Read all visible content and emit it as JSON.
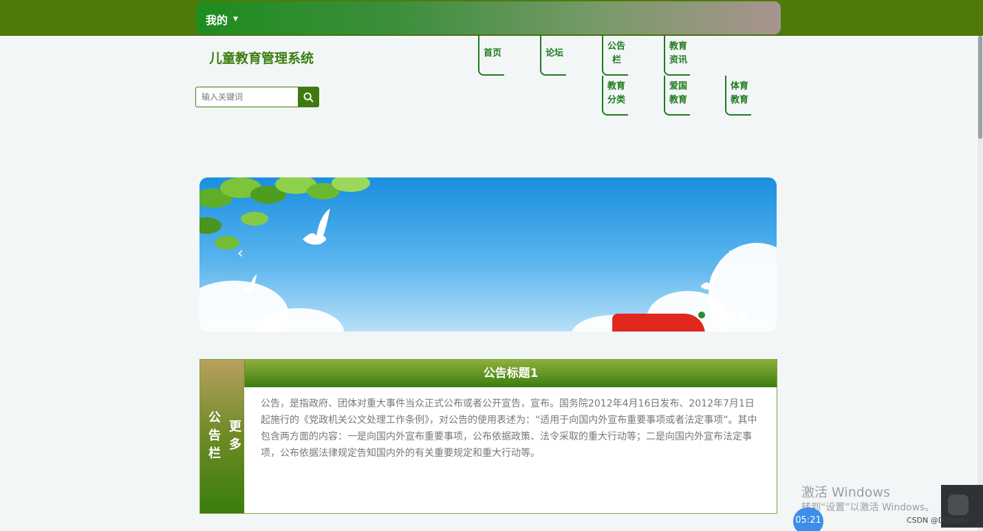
{
  "header": {
    "user_menu_label": "我的"
  },
  "site": {
    "title": "儿童教育管理系统"
  },
  "search": {
    "placeholder": "输入关键词"
  },
  "nav": {
    "home": "首页",
    "forum": "论坛",
    "notice_line1": "公告",
    "notice_line2": "栏",
    "edu_news_line1": "教育",
    "edu_news_line2": "资讯",
    "edu_category_line1": "教育",
    "edu_category_line2": "分类",
    "patriotic_line1": "爱国",
    "patriotic_line2": "教育",
    "sports_line1": "体育",
    "sports_line2": "教育"
  },
  "banner": {
    "prev_icon": "chevron-left-icon",
    "next_icon": "chevron-right-icon",
    "slide_count": 5,
    "active_slide": 1
  },
  "notice_section": {
    "label": "公告栏",
    "more": "更多",
    "title": "公告标题1",
    "body": "公告，是指政府、团体对重大事件当众正式公布或者公开宣告，宣布。国务院2012年4月16日发布、2012年7月1日起施行的《党政机关公文处理工作条例》，对公告的使用表述为：“适用于向国内外宣布重要事项或者法定事项”。其中包含两方面的内容：一是向国内外宣布重要事项，公布依据政策、法令采取的重大行动等；二是向国内外宣布法定事项，公布依据法律规定告知国内外的有关重要规定和重大行动等。"
  },
  "overlay": {
    "activate_title": "激活 Windows",
    "activate_sub": "转到“设置”以激活 Windows。",
    "timer": "05:21",
    "csdn": "CSDN @DZbishe"
  },
  "colors": {
    "primary_green": "#3a7d0e",
    "nav_green": "#1d7a1d",
    "topbar": "#4f7a0a"
  }
}
